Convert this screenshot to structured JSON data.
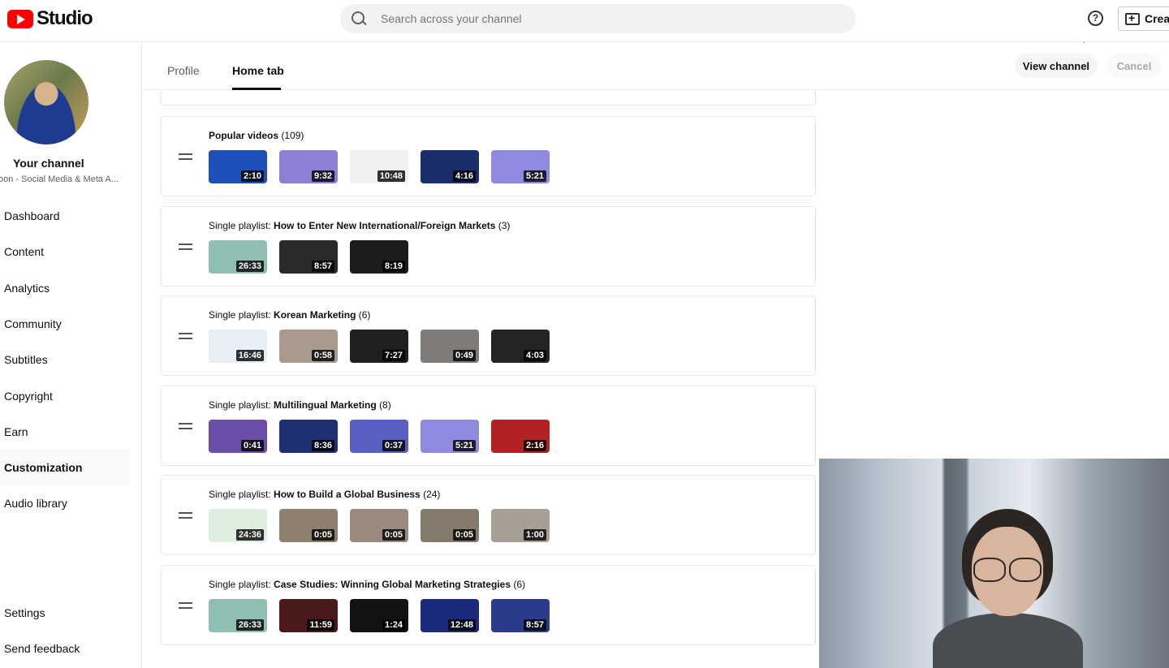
{
  "app": {
    "logo_text": "Studio"
  },
  "search": {
    "placeholder": "Search across your channel"
  },
  "header": {
    "create_label": "Crea"
  },
  "channel": {
    "title": "Your channel",
    "subtitle": "oon - Social Media & Meta A..."
  },
  "nav": {
    "items": [
      "Dashboard",
      "Content",
      "Analytics",
      "Community",
      "Subtitles",
      "Copyright",
      "Earn",
      "Customization",
      "Audio library"
    ],
    "active": "Customization",
    "bottom": [
      "Settings",
      "Send feedback"
    ]
  },
  "tabs": {
    "profile": "Profile",
    "home": "Home tab",
    "active": "Home tab"
  },
  "actions": {
    "view_channel": "View channel",
    "cancel": "Cancel"
  },
  "sections": [
    {
      "prefix": "",
      "name": "Popular videos",
      "count": "(109)",
      "videos": [
        {
          "duration": "2:10",
          "color": "#1f4fb8"
        },
        {
          "duration": "9:32",
          "color": "#8e7fd6"
        },
        {
          "duration": "10:48",
          "color": "#f0f0f0"
        },
        {
          "duration": "4:16",
          "color": "#1b2d6b"
        },
        {
          "duration": "5:21",
          "color": "#8f8ae0"
        }
      ]
    },
    {
      "prefix": "Single playlist: ",
      "name": "How to Enter New International/Foreign Markets",
      "count": "(3)",
      "videos": [
        {
          "duration": "26:33",
          "color": "#8fbfb3"
        },
        {
          "duration": "8:57",
          "color": "#2a2a2a"
        },
        {
          "duration": "8:19",
          "color": "#1c1c1c"
        }
      ]
    },
    {
      "prefix": "Single playlist: ",
      "name": "Korean Marketing",
      "count": "(6)",
      "videos": [
        {
          "duration": "16:46",
          "color": "#e8eef6"
        },
        {
          "duration": "0:58",
          "color": "#a89a8c"
        },
        {
          "duration": "7:27",
          "color": "#202020"
        },
        {
          "duration": "0:49",
          "color": "#7e7b78"
        },
        {
          "duration": "4:03",
          "color": "#242424"
        }
      ]
    },
    {
      "prefix": "Single playlist: ",
      "name": "Multilingual Marketing",
      "count": "(8)",
      "videos": [
        {
          "duration": "0:41",
          "color": "#6b4ea8"
        },
        {
          "duration": "8:36",
          "color": "#1e2f74"
        },
        {
          "duration": "0:37",
          "color": "#5a5fc4"
        },
        {
          "duration": "5:21",
          "color": "#8f8ae0"
        },
        {
          "duration": "2:16",
          "color": "#b32222"
        }
      ]
    },
    {
      "prefix": "Single playlist: ",
      "name": "How to Build a Global Business",
      "count": "(24)",
      "videos": [
        {
          "duration": "24:36",
          "color": "#dfeee0"
        },
        {
          "duration": "0:05",
          "color": "#8c7f6e"
        },
        {
          "duration": "0:05",
          "color": "#9a8a80"
        },
        {
          "duration": "0:05",
          "color": "#857a6c"
        },
        {
          "duration": "1:00",
          "color": "#a79e96"
        }
      ]
    },
    {
      "prefix": "Single playlist: ",
      "name": "Case Studies: Winning Global Marketing Strategies",
      "count": "(6)",
      "videos": [
        {
          "duration": "26:33",
          "color": "#8fbfb3"
        },
        {
          "duration": "11:59",
          "color": "#4a1a1a"
        },
        {
          "duration": "1:24",
          "color": "#121212"
        },
        {
          "duration": "12:48",
          "color": "#1b2a7a"
        },
        {
          "duration": "8:57",
          "color": "#2b3a8a"
        }
      ]
    }
  ]
}
